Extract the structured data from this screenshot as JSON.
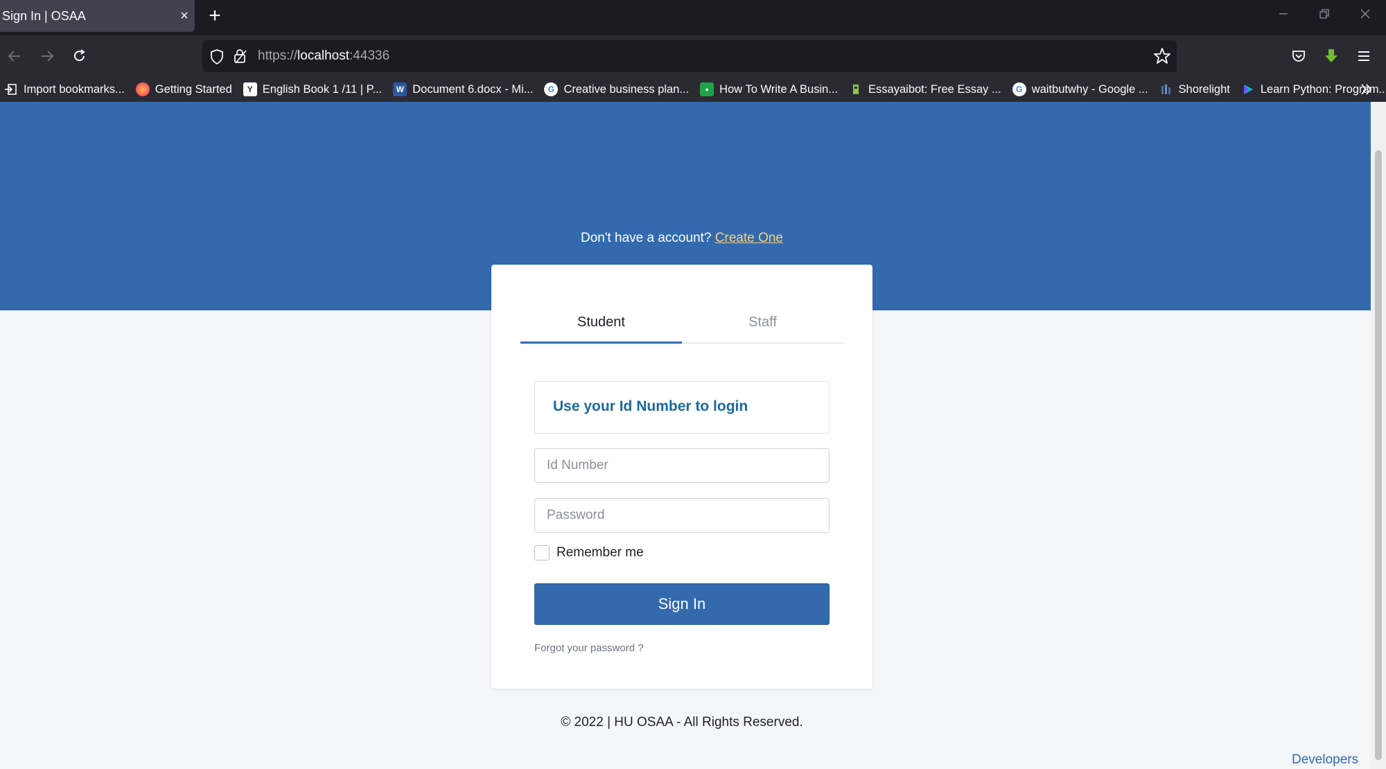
{
  "browser": {
    "tab_title": "Sign In | OSAA",
    "tab_close": "×",
    "new_tab": "+",
    "url_protocol": "https://",
    "url_host": "localhost",
    "url_port": ":44336",
    "bookmarks": [
      {
        "label": "Import bookmarks...",
        "icon": "import-icon",
        "color": "#2b2a33"
      },
      {
        "label": "Getting Started",
        "icon": "firefox-icon",
        "color": "#ff7139"
      },
      {
        "label": "English Book 1 /11 | P...",
        "icon": "y-icon",
        "color": "#ffffff"
      },
      {
        "label": "Document 6.docx - Mi...",
        "icon": "word-icon",
        "color": "#2b579a"
      },
      {
        "label": "Creative business plan...",
        "icon": "google-icon",
        "color": "#ffffff"
      },
      {
        "label": "How To Write A Busin...",
        "icon": "green-site-icon",
        "color": "#1ea446"
      },
      {
        "label": "Essayaibot: Free Essay ...",
        "icon": "essay-icon",
        "color": "#8bc34a"
      },
      {
        "label": "waitbutwhy - Google ...",
        "icon": "google-icon",
        "color": "#ffffff"
      },
      {
        "label": "Shorelight",
        "icon": "shorelight-icon",
        "color": "#4a6fa5"
      },
      {
        "label": "Learn Python: Program...",
        "icon": "play-icon",
        "color": "#00c4cc"
      }
    ]
  },
  "page": {
    "no_account_text": "Don't have a account?",
    "create_link": "Create One",
    "tabs": [
      {
        "label": "Student"
      },
      {
        "label": "Staff"
      }
    ],
    "notice": "Use your Id Number to login",
    "id_placeholder": "Id Number",
    "password_placeholder": "Password",
    "remember_label": "Remember me",
    "signin_label": "Sign In",
    "forgot_label": "Forgot your password ?",
    "copyright": "© 2022 | HU OSAA - All Rights Reserved.",
    "developers": "Developers",
    "accent_color": "#336aae",
    "link_color": "#f6cf7c"
  }
}
